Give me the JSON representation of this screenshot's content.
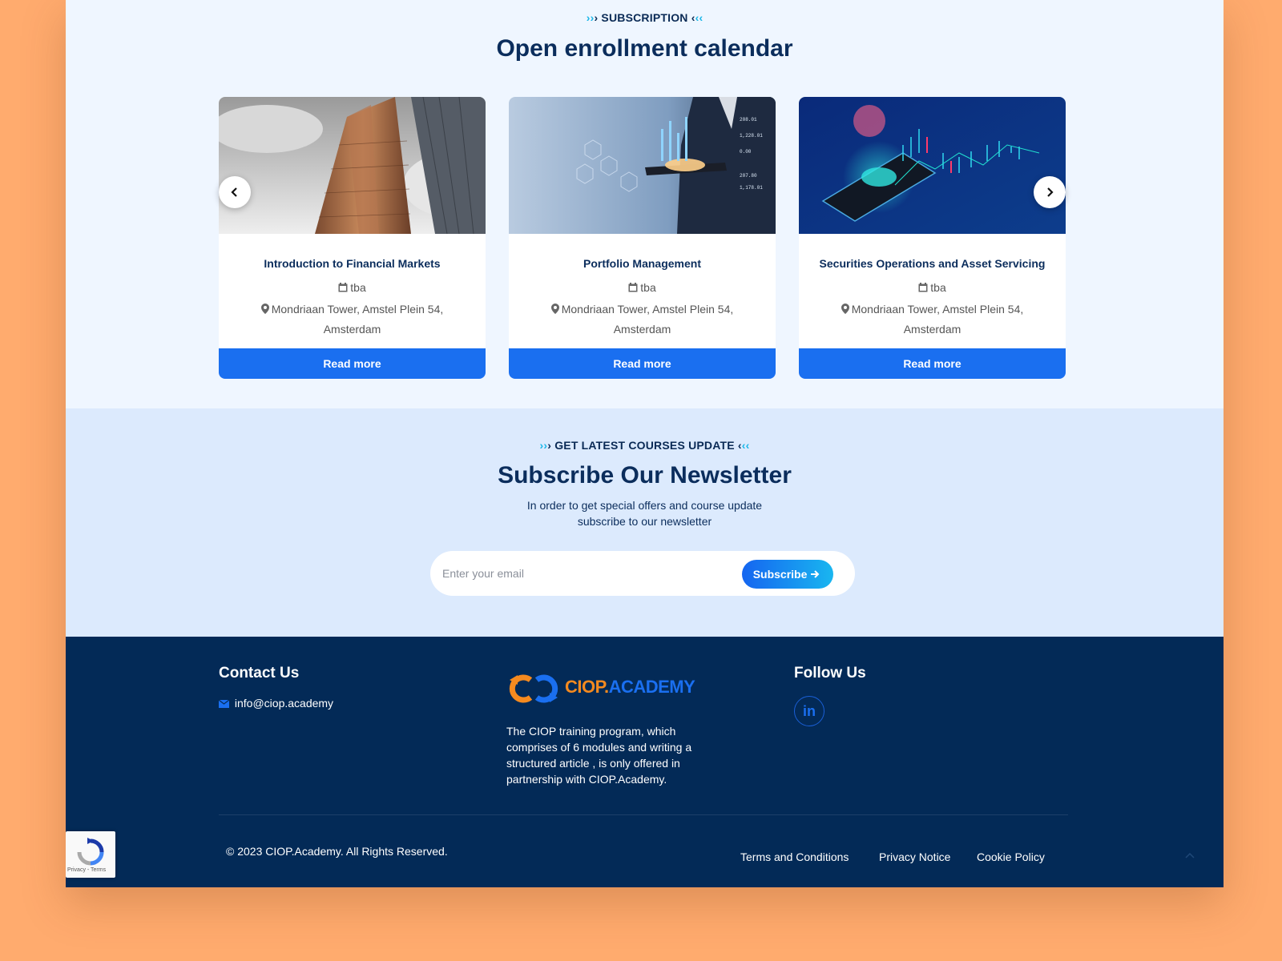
{
  "enrollment": {
    "eyebrow": "SUBSCRIPTION",
    "title": "Open enrollment calendar",
    "cards": [
      {
        "title": "Introduction to Financial Markets",
        "date": "tba",
        "location": "Mondriaan Tower, Amstel Plein 54, Amsterdam",
        "button": "Read more"
      },
      {
        "title": "Portfolio Management",
        "date": "tba",
        "location": "Mondriaan Tower, Amstel Plein 54, Amsterdam",
        "button": "Read more"
      },
      {
        "title": "Securities Operations and Asset Servicing",
        "date": "tba",
        "location": "Mondriaan Tower, Amstel Plein 54, Amsterdam",
        "button": "Read more"
      }
    ],
    "prev_icon": "chevron-left-icon",
    "next_icon": "chevron-right-icon"
  },
  "newsletter": {
    "eyebrow": "GET LATEST COURSES UPDATE",
    "title": "Subscribe Our Newsletter",
    "subtitle_line1": "In order to get special offers and course update",
    "subtitle_line2": "subscribe to our newsletter",
    "email_placeholder": "Enter your email",
    "button": "Subscribe"
  },
  "footer": {
    "contact_title": "Contact Us",
    "email": "info@ciop.academy",
    "logo_text_a": "CIOP.",
    "logo_text_b": "ACADEMY",
    "description": "The CIOP training program, which comprises of 6 modules and writing a structured article , is only offered in partnership with CIOP.Academy.",
    "follow_title": "Follow Us",
    "social_label": "in",
    "copyright": "© 2023 CIOP.Academy. All Rights Reserved.",
    "links": [
      "Terms and Conditions",
      "Privacy Notice",
      "Cookie Policy"
    ]
  },
  "recaptcha": {
    "text": "Privacy - Terms"
  },
  "colors": {
    "primary_blue": "#1a6ff0",
    "navy": "#032a57",
    "accent_cyan": "#19b6e8",
    "logo_orange": "#f58a1f",
    "page_bg": "#FFAB6E"
  }
}
